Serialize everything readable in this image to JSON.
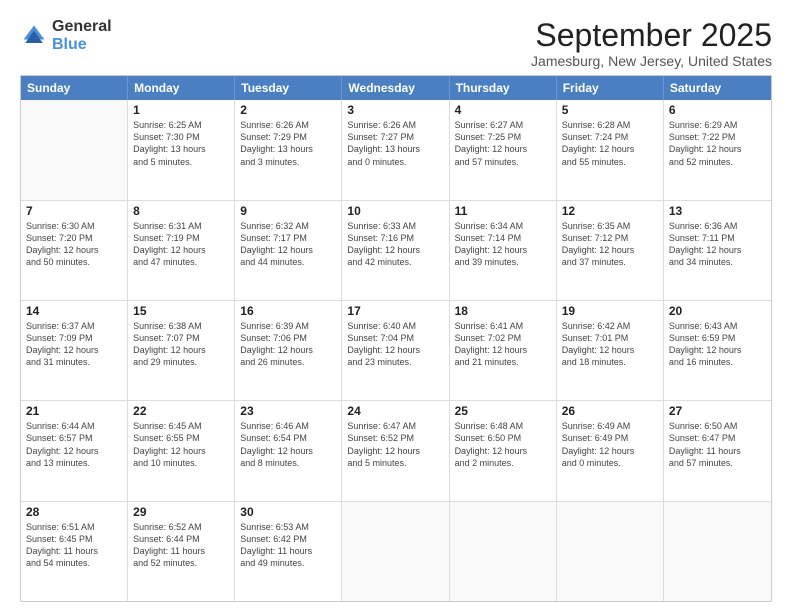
{
  "logo": {
    "general": "General",
    "blue": "Blue"
  },
  "title": {
    "month": "September 2025",
    "location": "Jamesburg, New Jersey, United States"
  },
  "weekdays": [
    "Sunday",
    "Monday",
    "Tuesday",
    "Wednesday",
    "Thursday",
    "Friday",
    "Saturday"
  ],
  "rows": [
    [
      {
        "day": "",
        "lines": []
      },
      {
        "day": "1",
        "lines": [
          "Sunrise: 6:25 AM",
          "Sunset: 7:30 PM",
          "Daylight: 13 hours",
          "and 5 minutes."
        ]
      },
      {
        "day": "2",
        "lines": [
          "Sunrise: 6:26 AM",
          "Sunset: 7:29 PM",
          "Daylight: 13 hours",
          "and 3 minutes."
        ]
      },
      {
        "day": "3",
        "lines": [
          "Sunrise: 6:26 AM",
          "Sunset: 7:27 PM",
          "Daylight: 13 hours",
          "and 0 minutes."
        ]
      },
      {
        "day": "4",
        "lines": [
          "Sunrise: 6:27 AM",
          "Sunset: 7:25 PM",
          "Daylight: 12 hours",
          "and 57 minutes."
        ]
      },
      {
        "day": "5",
        "lines": [
          "Sunrise: 6:28 AM",
          "Sunset: 7:24 PM",
          "Daylight: 12 hours",
          "and 55 minutes."
        ]
      },
      {
        "day": "6",
        "lines": [
          "Sunrise: 6:29 AM",
          "Sunset: 7:22 PM",
          "Daylight: 12 hours",
          "and 52 minutes."
        ]
      }
    ],
    [
      {
        "day": "7",
        "lines": [
          "Sunrise: 6:30 AM",
          "Sunset: 7:20 PM",
          "Daylight: 12 hours",
          "and 50 minutes."
        ]
      },
      {
        "day": "8",
        "lines": [
          "Sunrise: 6:31 AM",
          "Sunset: 7:19 PM",
          "Daylight: 12 hours",
          "and 47 minutes."
        ]
      },
      {
        "day": "9",
        "lines": [
          "Sunrise: 6:32 AM",
          "Sunset: 7:17 PM",
          "Daylight: 12 hours",
          "and 44 minutes."
        ]
      },
      {
        "day": "10",
        "lines": [
          "Sunrise: 6:33 AM",
          "Sunset: 7:16 PM",
          "Daylight: 12 hours",
          "and 42 minutes."
        ]
      },
      {
        "day": "11",
        "lines": [
          "Sunrise: 6:34 AM",
          "Sunset: 7:14 PM",
          "Daylight: 12 hours",
          "and 39 minutes."
        ]
      },
      {
        "day": "12",
        "lines": [
          "Sunrise: 6:35 AM",
          "Sunset: 7:12 PM",
          "Daylight: 12 hours",
          "and 37 minutes."
        ]
      },
      {
        "day": "13",
        "lines": [
          "Sunrise: 6:36 AM",
          "Sunset: 7:11 PM",
          "Daylight: 12 hours",
          "and 34 minutes."
        ]
      }
    ],
    [
      {
        "day": "14",
        "lines": [
          "Sunrise: 6:37 AM",
          "Sunset: 7:09 PM",
          "Daylight: 12 hours",
          "and 31 minutes."
        ]
      },
      {
        "day": "15",
        "lines": [
          "Sunrise: 6:38 AM",
          "Sunset: 7:07 PM",
          "Daylight: 12 hours",
          "and 29 minutes."
        ]
      },
      {
        "day": "16",
        "lines": [
          "Sunrise: 6:39 AM",
          "Sunset: 7:06 PM",
          "Daylight: 12 hours",
          "and 26 minutes."
        ]
      },
      {
        "day": "17",
        "lines": [
          "Sunrise: 6:40 AM",
          "Sunset: 7:04 PM",
          "Daylight: 12 hours",
          "and 23 minutes."
        ]
      },
      {
        "day": "18",
        "lines": [
          "Sunrise: 6:41 AM",
          "Sunset: 7:02 PM",
          "Daylight: 12 hours",
          "and 21 minutes."
        ]
      },
      {
        "day": "19",
        "lines": [
          "Sunrise: 6:42 AM",
          "Sunset: 7:01 PM",
          "Daylight: 12 hours",
          "and 18 minutes."
        ]
      },
      {
        "day": "20",
        "lines": [
          "Sunrise: 6:43 AM",
          "Sunset: 6:59 PM",
          "Daylight: 12 hours",
          "and 16 minutes."
        ]
      }
    ],
    [
      {
        "day": "21",
        "lines": [
          "Sunrise: 6:44 AM",
          "Sunset: 6:57 PM",
          "Daylight: 12 hours",
          "and 13 minutes."
        ]
      },
      {
        "day": "22",
        "lines": [
          "Sunrise: 6:45 AM",
          "Sunset: 6:55 PM",
          "Daylight: 12 hours",
          "and 10 minutes."
        ]
      },
      {
        "day": "23",
        "lines": [
          "Sunrise: 6:46 AM",
          "Sunset: 6:54 PM",
          "Daylight: 12 hours",
          "and 8 minutes."
        ]
      },
      {
        "day": "24",
        "lines": [
          "Sunrise: 6:47 AM",
          "Sunset: 6:52 PM",
          "Daylight: 12 hours",
          "and 5 minutes."
        ]
      },
      {
        "day": "25",
        "lines": [
          "Sunrise: 6:48 AM",
          "Sunset: 6:50 PM",
          "Daylight: 12 hours",
          "and 2 minutes."
        ]
      },
      {
        "day": "26",
        "lines": [
          "Sunrise: 6:49 AM",
          "Sunset: 6:49 PM",
          "Daylight: 12 hours",
          "and 0 minutes."
        ]
      },
      {
        "day": "27",
        "lines": [
          "Sunrise: 6:50 AM",
          "Sunset: 6:47 PM",
          "Daylight: 11 hours",
          "and 57 minutes."
        ]
      }
    ],
    [
      {
        "day": "28",
        "lines": [
          "Sunrise: 6:51 AM",
          "Sunset: 6:45 PM",
          "Daylight: 11 hours",
          "and 54 minutes."
        ]
      },
      {
        "day": "29",
        "lines": [
          "Sunrise: 6:52 AM",
          "Sunset: 6:44 PM",
          "Daylight: 11 hours",
          "and 52 minutes."
        ]
      },
      {
        "day": "30",
        "lines": [
          "Sunrise: 6:53 AM",
          "Sunset: 6:42 PM",
          "Daylight: 11 hours",
          "and 49 minutes."
        ]
      },
      {
        "day": "",
        "lines": []
      },
      {
        "day": "",
        "lines": []
      },
      {
        "day": "",
        "lines": []
      },
      {
        "day": "",
        "lines": []
      }
    ]
  ]
}
